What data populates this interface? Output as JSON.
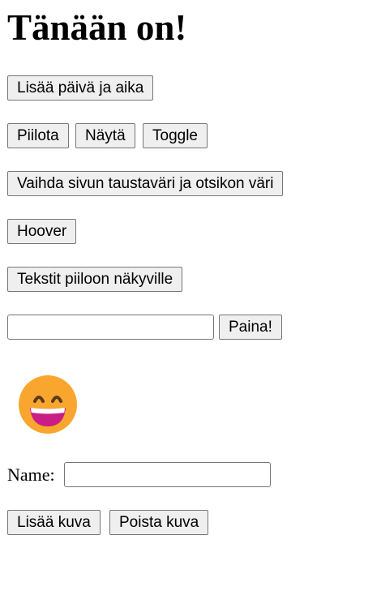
{
  "heading": "Tänään on!",
  "buttons": {
    "add_datetime": "Lisää päivä ja aika",
    "hide": "Piilota",
    "show": "Näytä",
    "toggle": "Toggle",
    "change_colors": "Vaihda sivun taustaväri ja otsikon väri",
    "hover": "Hoover",
    "toggle_texts": "Tekstit piiloon näkyville",
    "press": "Paina!",
    "add_image": "Lisää kuva",
    "remove_image": "Poista kuva"
  },
  "text_input": {
    "value": "",
    "placeholder": ""
  },
  "name_field": {
    "label": "Name:",
    "value": "",
    "placeholder": ""
  },
  "image": {
    "icon": "grinning-face-icon",
    "colors": {
      "face": "#F9A62E",
      "mouth": "#C81E86",
      "eyes": "#5B3A1E"
    }
  }
}
